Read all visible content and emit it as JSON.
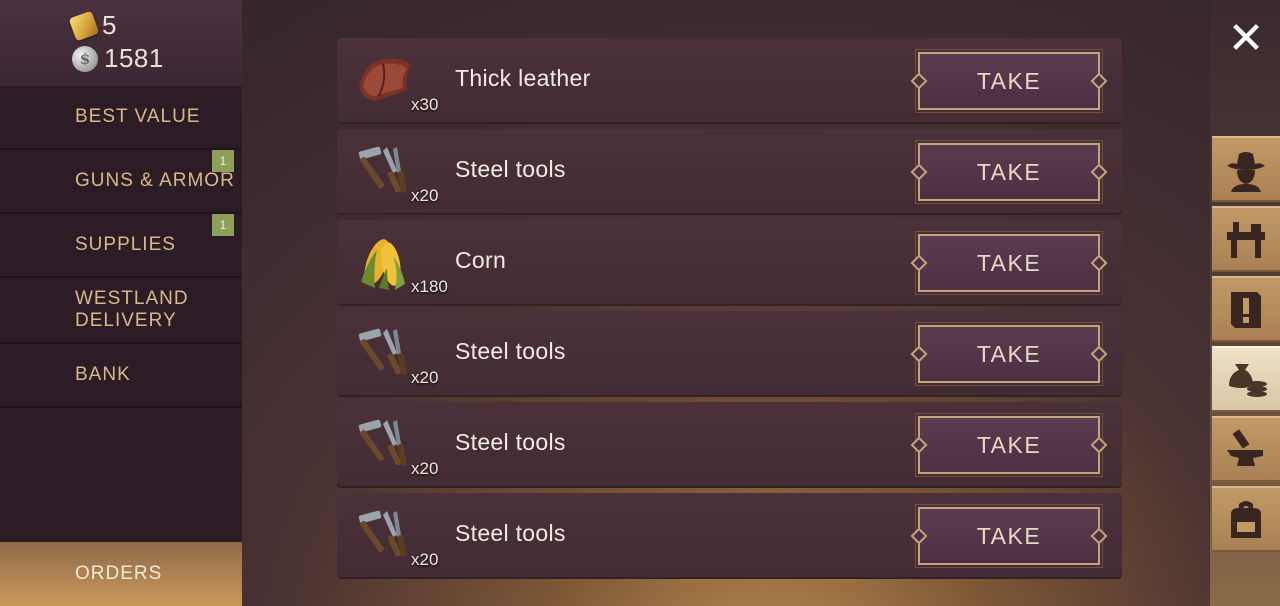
{
  "currency": {
    "gold": "5",
    "silver": "1581"
  },
  "sidebar": {
    "items": [
      {
        "label": "BEST VALUE",
        "badge": ""
      },
      {
        "label": "GUNS & ARMOR",
        "badge": "1"
      },
      {
        "label": "SUPPLIES",
        "badge": "1"
      },
      {
        "label": "WESTLAND\nDELIVERY",
        "badge": ""
      },
      {
        "label": "BANK",
        "badge": ""
      }
    ],
    "active": {
      "label": "ORDERS"
    }
  },
  "orders": [
    {
      "name": "Thick leather",
      "qty": "x30",
      "icon": "leather-icon",
      "button": "TAKE"
    },
    {
      "name": "Steel tools",
      "qty": "x20",
      "icon": "tools-icon",
      "button": "TAKE"
    },
    {
      "name": "Corn",
      "qty": "x180",
      "icon": "corn-icon",
      "button": "TAKE"
    },
    {
      "name": "Steel tools",
      "qty": "x20",
      "icon": "tools-icon",
      "button": "TAKE"
    },
    {
      "name": "Steel tools",
      "qty": "x20",
      "icon": "tools-icon",
      "button": "TAKE"
    },
    {
      "name": "Steel tools",
      "qty": "x20",
      "icon": "tools-icon",
      "button": "TAKE"
    }
  ],
  "rail": {
    "close_icon": "close-icon",
    "tabs": [
      "cowboy-icon",
      "workbench-icon",
      "quest-icon",
      "trade-icon",
      "anvil-icon",
      "backpack-icon"
    ],
    "active_tab": "trade-icon"
  },
  "colors": {
    "accent_gold": "#d9b98a",
    "button_border": "#c4a47a",
    "badge_green": "#8da05a"
  }
}
